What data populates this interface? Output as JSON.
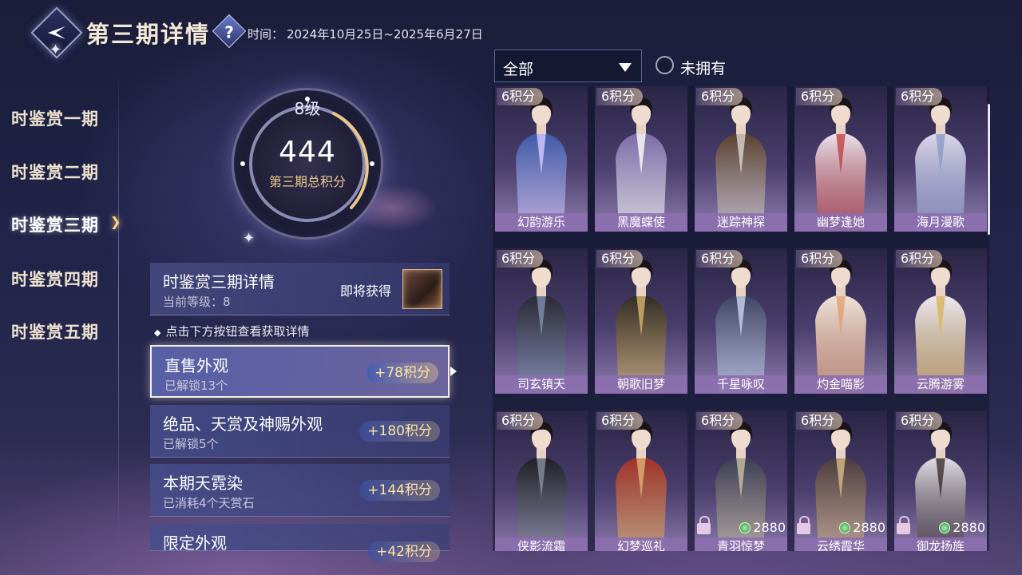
{
  "header": {
    "title": "第三期详情",
    "help_icon": "question-icon",
    "period_label": "时间：",
    "period_value": "2024年10月25日~2025年6月27日"
  },
  "nav": {
    "items": [
      {
        "label": "时鉴赏一期"
      },
      {
        "label": "时鉴赏二期"
      },
      {
        "label": "时鉴赏三期",
        "active": true
      },
      {
        "label": "时鉴赏四期"
      },
      {
        "label": "时鉴赏五期"
      }
    ]
  },
  "level_ring": {
    "level": "8级",
    "points": "444",
    "caption": "第三期总积分"
  },
  "detail": {
    "title": "时鉴赏三期详情",
    "current_level": "当前等级：8",
    "soon_label": "即将获得",
    "hint": "点击下方按钮查看获取详情"
  },
  "items": [
    {
      "title": "直售外观",
      "sub": "已解锁13个",
      "points": "+78积分",
      "selected": true
    },
    {
      "title": "绝品、天赏及神赐外观",
      "sub": "已解锁5个",
      "points": "+180积分"
    },
    {
      "title": "本期天霓染",
      "sub": "已消耗4个天赏石",
      "points": "+144积分"
    },
    {
      "title": "限定外观",
      "sub": "",
      "points": "+42积分"
    }
  ],
  "filter": {
    "dropdown_value": "全部",
    "radio_label": "未拥有"
  },
  "outfits": [
    {
      "name": "幻韵游乐",
      "badge": "6积分",
      "color": "#3b5aa8",
      "accent": "#d8c9ff"
    },
    {
      "name": "黑魔蝶使",
      "badge": "6积分",
      "color": "#7a6aa8",
      "accent": "#ffffff"
    },
    {
      "name": "迷踪神探",
      "badge": "6积分",
      "color": "#5a3f2e",
      "accent": "#d9d4cf"
    },
    {
      "name": "幽梦逢她",
      "badge": "6积分",
      "color": "#e9e4ef",
      "accent": "#c0413e"
    },
    {
      "name": "海月漫歌",
      "badge": "6积分",
      "color": "#dcd7ea",
      "accent": "#8b98c9"
    },
    {
      "name": "司玄镇天",
      "badge": "6积分",
      "color": "#2a2a33",
      "accent": "#8090b0"
    },
    {
      "name": "朝歌旧梦",
      "badge": "6积分",
      "color": "#2f2a24",
      "accent": "#d6b46b"
    },
    {
      "name": "千星咏叹",
      "badge": "6积分",
      "color": "#3d4360",
      "accent": "#c9d5f0"
    },
    {
      "name": "灼金喵影",
      "badge": "6积分",
      "color": "#f0e4dc",
      "accent": "#e0a070"
    },
    {
      "name": "云腾游雾",
      "badge": "6积分",
      "color": "#ece8f3",
      "accent": "#d9b45a"
    },
    {
      "name": "侠影流霜",
      "badge": "6积分",
      "color": "#1f1f26",
      "accent": "#8a8fa0"
    },
    {
      "name": "幻梦巡礼",
      "badge": "6积分",
      "color": "#a0302a",
      "accent": "#e0b070"
    },
    {
      "name": "青羽惊梦",
      "badge": "6积分",
      "color": "#3a3c55",
      "accent": "#c9c0a0",
      "locked": true,
      "price": "2880"
    },
    {
      "name": "云绣霞华",
      "badge": "6积分",
      "color": "#4a3a40",
      "accent": "#d8b88a",
      "locked": true,
      "price": "2880"
    },
    {
      "name": "御龙扬旌",
      "badge": "6积分",
      "color": "#e4e0e6",
      "accent": "#3a3030",
      "locked": true,
      "price": "2880"
    }
  ]
}
